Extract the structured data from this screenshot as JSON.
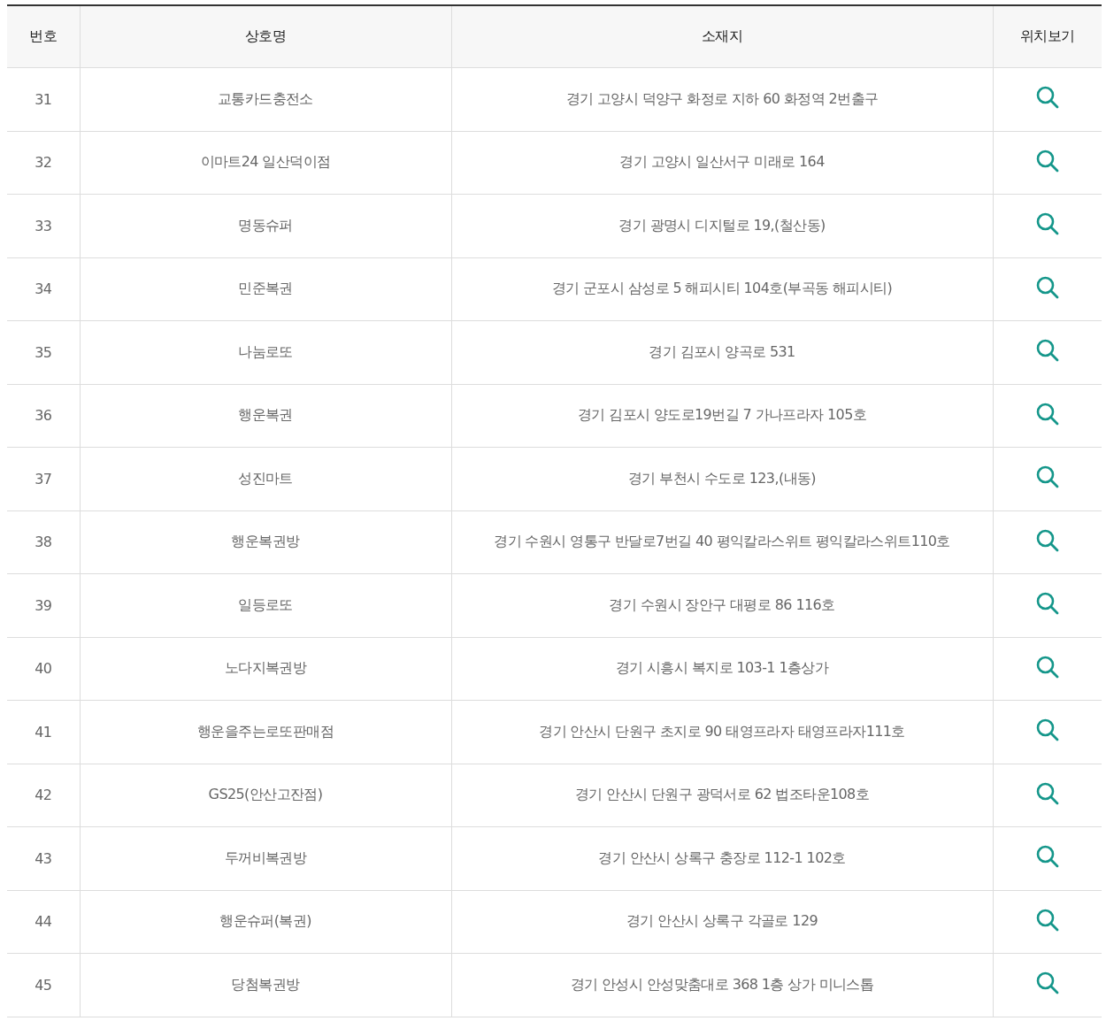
{
  "table": {
    "columns": [
      "번호",
      "상호명",
      "소재지",
      "위치보기"
    ],
    "rows": [
      {
        "number": "31",
        "name": "교통카드충전소",
        "address": "경기 고양시 덕양구 화정로 지하 60 화정역 2번출구"
      },
      {
        "number": "32",
        "name": "이마트24 일산덕이점",
        "address": "경기 고양시 일산서구 미래로 164"
      },
      {
        "number": "33",
        "name": "명동슈퍼",
        "address": "경기 광명시 디지털로 19,(철산동)"
      },
      {
        "number": "34",
        "name": "민준복권",
        "address": "경기 군포시 삼성로 5 해피시티 104호(부곡동 해피시티)"
      },
      {
        "number": "35",
        "name": "나눔로또",
        "address": "경기 김포시 양곡로 531"
      },
      {
        "number": "36",
        "name": "행운복권",
        "address": "경기 김포시 양도로19번길 7 가나프라자 105호"
      },
      {
        "number": "37",
        "name": "성진마트",
        "address": "경기 부천시 수도로 123,(내동)"
      },
      {
        "number": "38",
        "name": "행운복권방",
        "address": "경기 수원시 영통구 반달로7번길 40 평익칼라스위트 평익칼라스위트110호"
      },
      {
        "number": "39",
        "name": "일등로또",
        "address": "경기 수원시 장안구 대평로 86 116호"
      },
      {
        "number": "40",
        "name": "노다지복권방",
        "address": "경기 시흥시 복지로 103-1 1층상가"
      },
      {
        "number": "41",
        "name": "행운을주는로또판매점",
        "address": "경기 안산시 단원구 초지로 90 태영프라자 태영프라자111호"
      },
      {
        "number": "42",
        "name": "GS25(안산고잔점)",
        "address": "경기 안산시 단원구 광덕서로 62 법조타운108호"
      },
      {
        "number": "43",
        "name": "두꺼비복권방",
        "address": "경기 안산시 상록구 충장로 112-1 102호"
      },
      {
        "number": "44",
        "name": "행운슈퍼(복권)",
        "address": "경기 안산시 상록구 각골로 129"
      },
      {
        "number": "45",
        "name": "당첨복권방",
        "address": "경기 안성시 안성맞춤대로 368 1층 상가 미니스톱"
      }
    ]
  }
}
